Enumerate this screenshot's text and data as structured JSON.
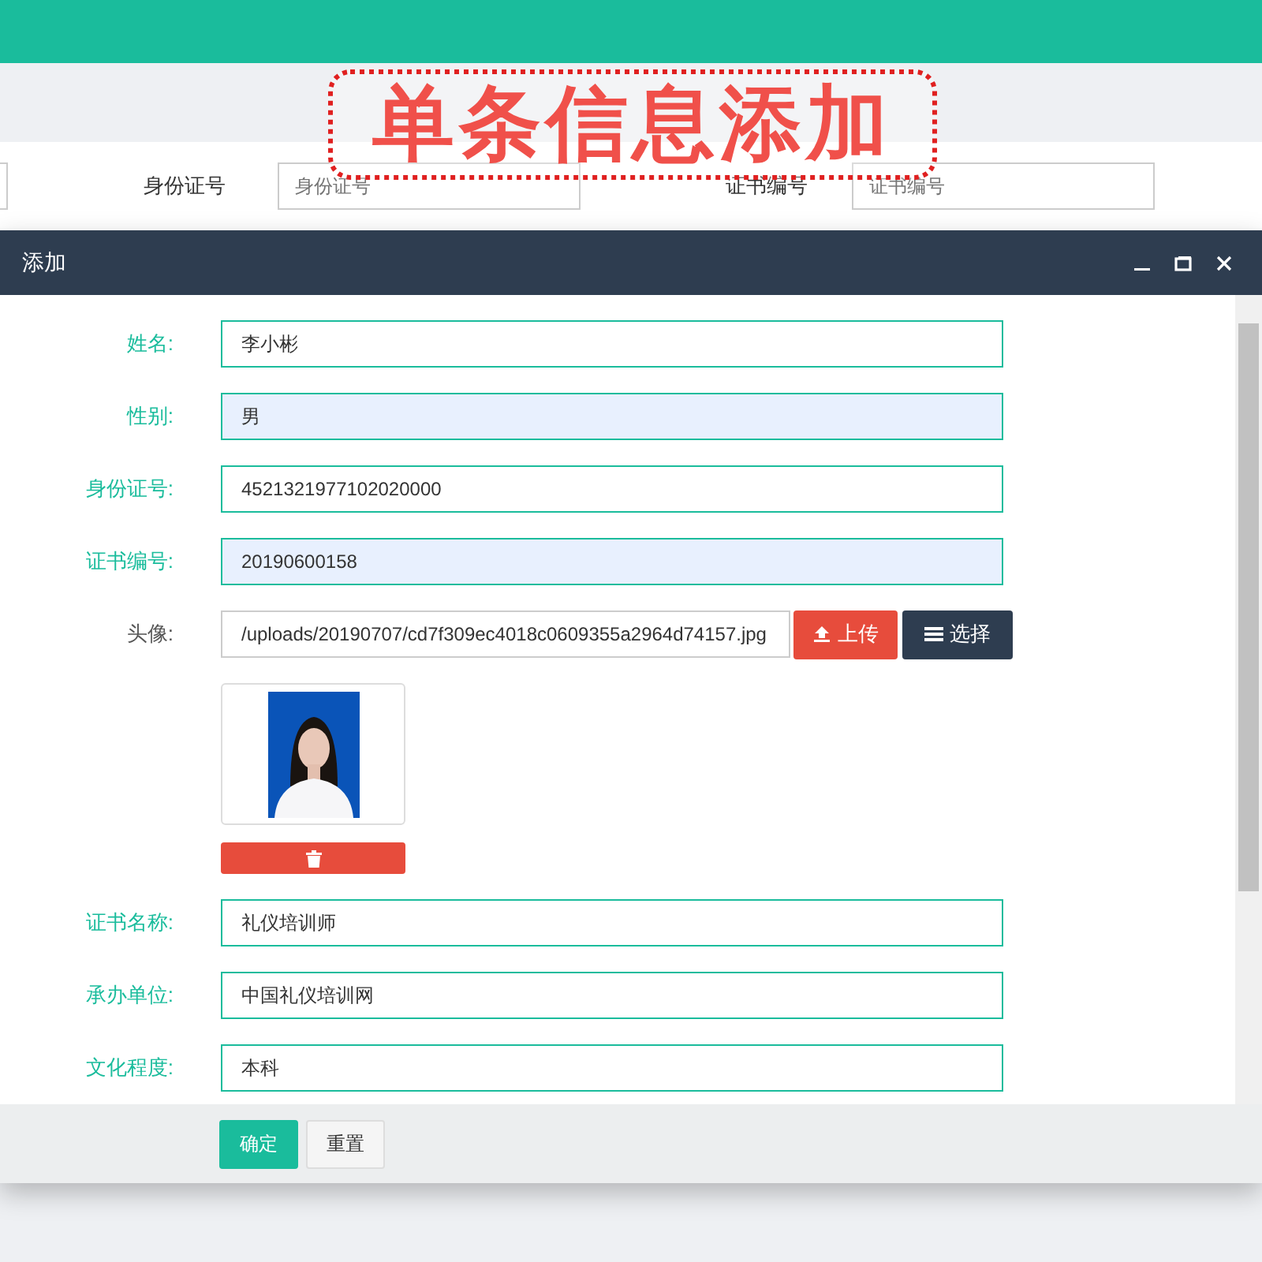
{
  "banner": {
    "title": "单条信息添加"
  },
  "search": [
    {
      "label": "身份证号",
      "placeholder": "身份证号"
    },
    {
      "label": "证书编号",
      "placeholder": "证书编号"
    }
  ],
  "dialog": {
    "title": "添加",
    "fields_before": [
      {
        "label": "姓名:",
        "value": "李小彬",
        "highlighted": false
      },
      {
        "label": "性别:",
        "value": "男",
        "highlighted": true
      },
      {
        "label": "身份证号:",
        "value": "4521321977102020000",
        "highlighted": false
      },
      {
        "label": "证书编号:",
        "value": "20190600158",
        "highlighted": true
      }
    ],
    "avatar": {
      "label": "头像:",
      "value": "/uploads/20190707/cd7f309ec4018c0609355a2964d74157.jpg",
      "upload": "上传",
      "choose": "选择"
    },
    "fields_after": [
      {
        "label": "证书名称:",
        "value": "礼仪培训师",
        "highlighted": false
      },
      {
        "label": "承办单位:",
        "value": "中国礼仪培训网",
        "highlighted": false
      },
      {
        "label": "文化程度:",
        "value": "本科",
        "highlighted": false
      }
    ],
    "buttons": [
      {
        "label": "确定",
        "kind": "primary"
      },
      {
        "label": "重置",
        "kind": "default"
      }
    ]
  }
}
